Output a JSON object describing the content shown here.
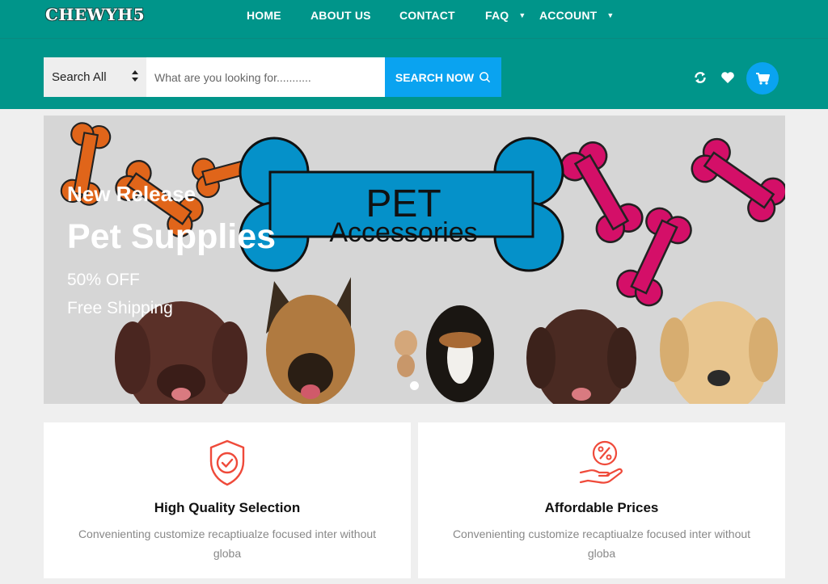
{
  "brand": {
    "logo": "CHEWYH5"
  },
  "nav": {
    "items": [
      {
        "label": "HOME"
      },
      {
        "label": "ABOUT US"
      },
      {
        "label": "CONTACT"
      },
      {
        "label": "FAQ"
      },
      {
        "label": "ACCOUNT"
      }
    ]
  },
  "search": {
    "category": "Search All",
    "placeholder": "What are you looking for...........",
    "button": "SEARCH NOW"
  },
  "header_icons": [
    "refresh-icon",
    "heart-icon",
    "cart-icon"
  ],
  "hero": {
    "kicker": "New Release",
    "title": "Pet Supplies",
    "line1": "50% OFF",
    "line2": "Free Shipping",
    "banner_word1": "PET",
    "banner_word2": "Accessories"
  },
  "features": [
    {
      "title": "High Quality Selection",
      "desc": "Convenienting customize recaptiualze focused inter without globa",
      "icon": "shield-check-icon"
    },
    {
      "title": "Affordable Prices",
      "desc": "Convenienting customize recaptiualze focused inter without globa",
      "icon": "hand-percent-icon"
    }
  ],
  "colors": {
    "teal": "#00958a",
    "accent_blue": "#0aa3f0",
    "icon_red": "#ef4a3a"
  }
}
